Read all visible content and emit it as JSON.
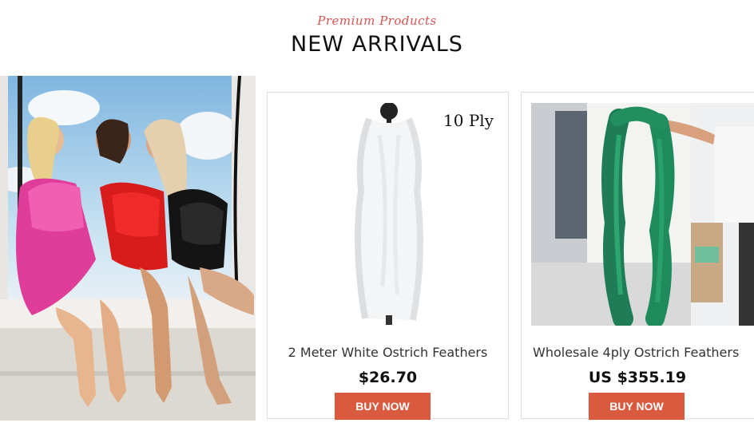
{
  "header": {
    "subtitle": "Premium Products",
    "title": "NEW ARRIVALS"
  },
  "products": [
    {
      "name": "2 Meter White Ostrich Feathers",
      "price": "$26.70",
      "badge": "10 Ply",
      "button_label": "BUY NOW"
    },
    {
      "name": "Wholesale 4ply Ostrich Feathers",
      "price": "US $355.19",
      "button_label": "BUY NOW"
    }
  ],
  "colors": {
    "accent": "#d95a3e",
    "subtitle": "#d9534f"
  }
}
